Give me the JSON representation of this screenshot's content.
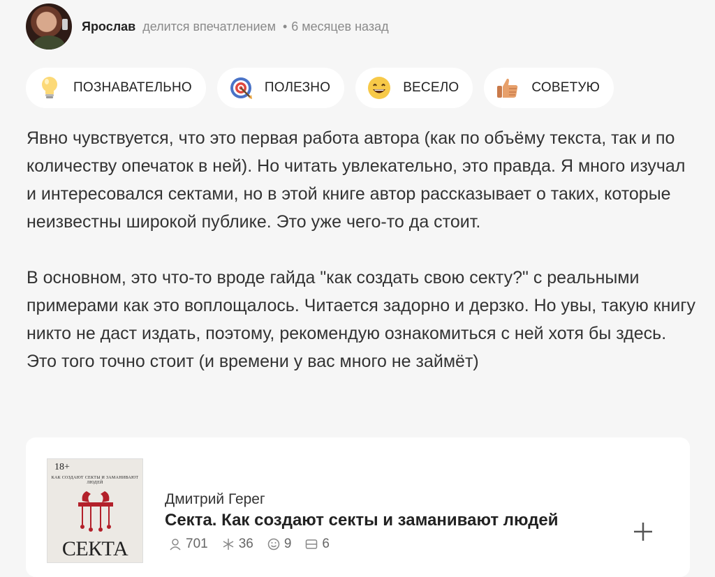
{
  "review_header": {
    "author": "Ярослав",
    "action": "делится впечатлением",
    "separator": "•",
    "time": "6 месяцев назад"
  },
  "tags": [
    {
      "icon": "lightbulb-icon",
      "label": "ПОЗНАВАТЕЛЬНО"
    },
    {
      "icon": "target-icon",
      "label": "ПОЛЕЗНО"
    },
    {
      "icon": "smile-icon",
      "label": "ВЕСЕЛО"
    },
    {
      "icon": "thumbs-up-icon",
      "label": "СОВЕТУЮ"
    }
  ],
  "review": {
    "paragraphs": [
      "Явно чувствуется, что это первая работа автора (как по объёму текста, так и по количеству опечаток в ней). Но читать увлекательно, это правда. Я много изучал и интересовался сектами, но в этой книге автор рассказывает о таких, которые неизвестны широкой публике. Это уже чего-то да стоит.",
      "В основном, это что-то вроде гайда \"как создать свою секту?\" с реальными примерами как это воплощалось. Читается задорно и дерзко. Но увы, такую книгу никто не даст издать, поэтому, рекомендую ознакомиться с ней хотя бы здесь. Это того точно стоит (и времени у вас много не займёт)"
    ]
  },
  "book": {
    "cover_age": "18+",
    "cover_subtitle": "КАК СОЗДАЮТ СЕКТЫ И ЗАМАНИВАЮТ ЛЮДЕЙ",
    "cover_title": "СЕКТА",
    "author": "Дмитрий Герег",
    "title": "Секта. Как создают секты и заманивают людей",
    "stats": {
      "readers": "701",
      "quotes": "36",
      "impressions": "9",
      "bookshelves": "6"
    }
  },
  "colors": {
    "background": "#f6f6f6",
    "card": "#ffffff",
    "muted_text": "#8a8a8a",
    "cover_red": "#b3202a"
  }
}
